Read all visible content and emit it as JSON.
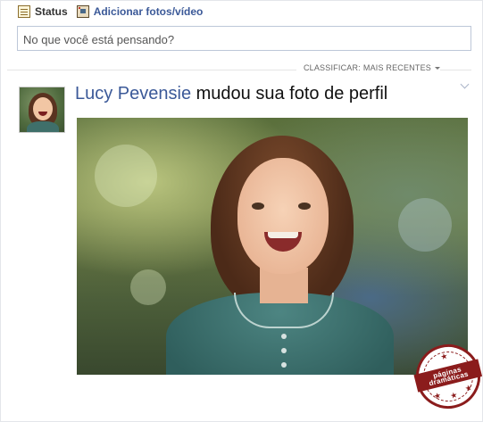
{
  "composer": {
    "tabs": [
      {
        "label": "Status",
        "icon": "status-icon"
      },
      {
        "label": "Adicionar fotos/vídeo",
        "icon": "photo-icon"
      }
    ],
    "placeholder": "No que você está pensando?"
  },
  "feed_sort": {
    "label": "CLASSIFICAR:",
    "value": "MAIS RECENTES"
  },
  "story": {
    "author": "Lucy Pevensie",
    "action": "mudou sua foto de perfil"
  },
  "watermark": {
    "line1": "páginas",
    "line2": "dramáticas"
  },
  "colors": {
    "link": "#3b5998",
    "border": "#bdc7d8",
    "watermark": "#8b1c1c"
  }
}
